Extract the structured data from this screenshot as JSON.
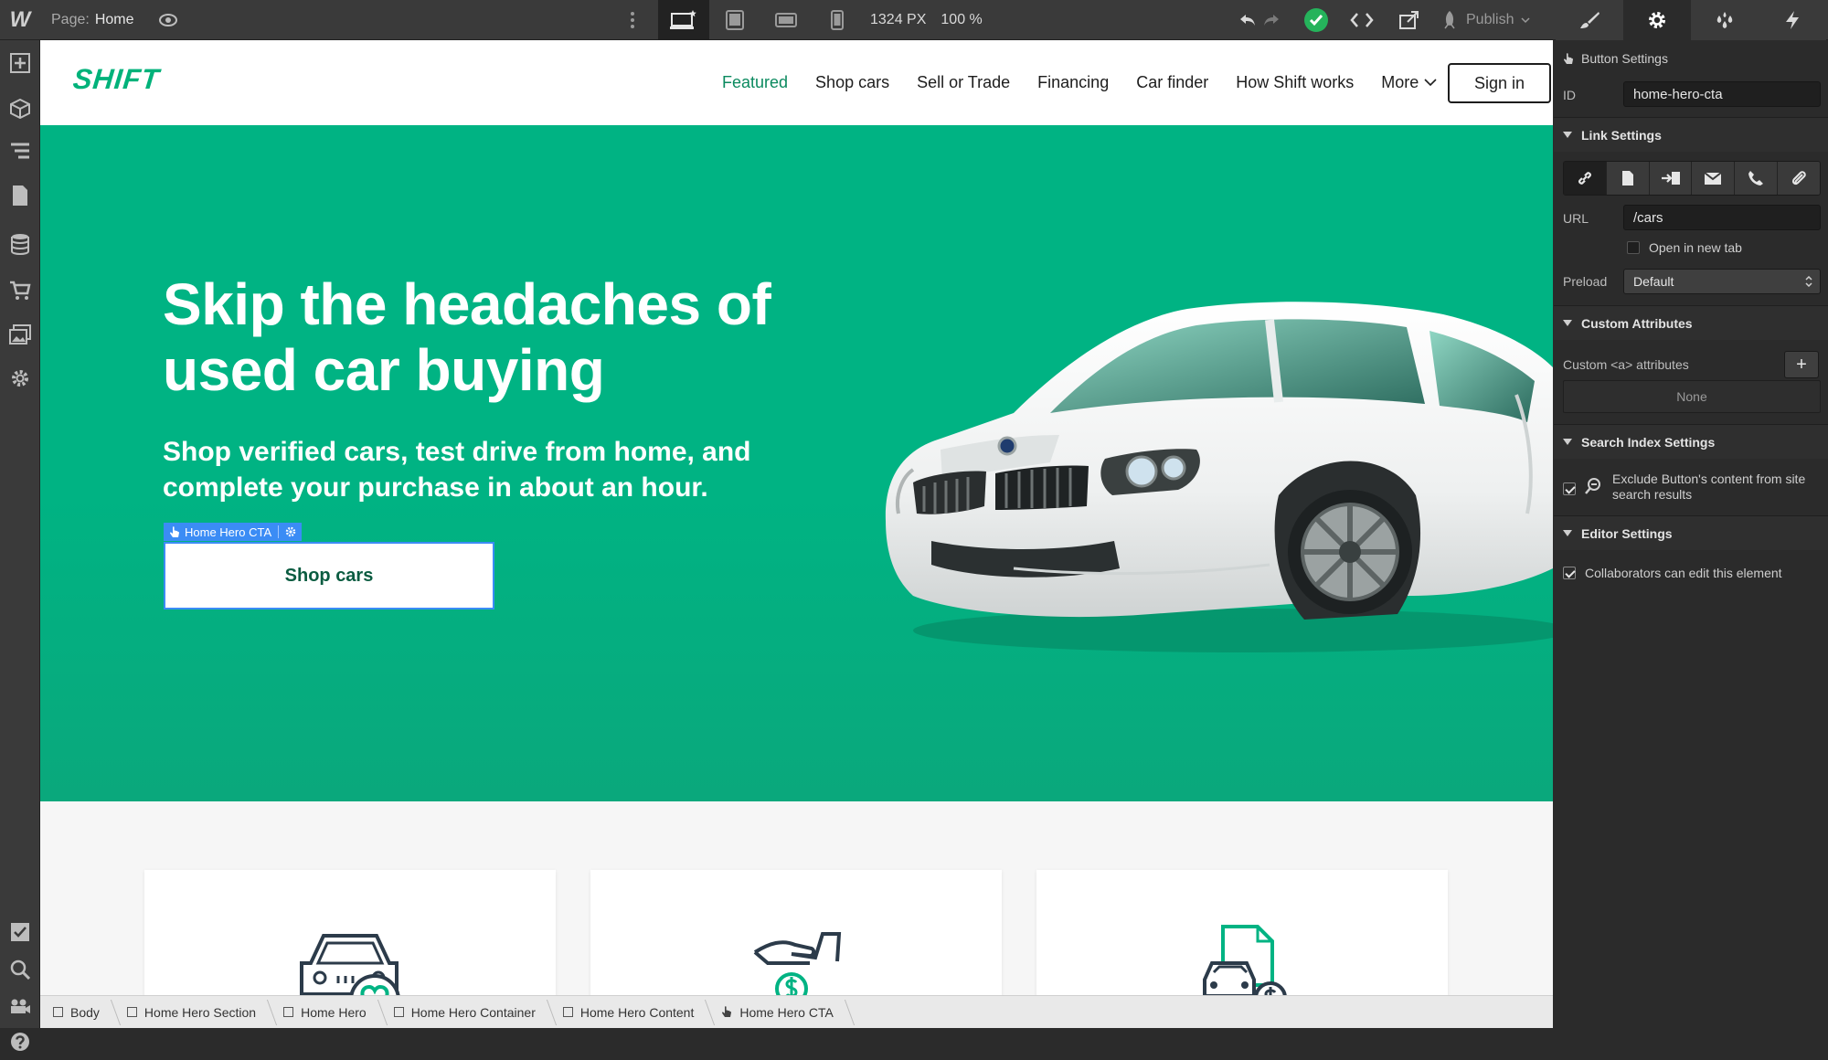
{
  "topbar": {
    "logo": "W",
    "page_label": "Page:",
    "page_name": "Home",
    "canvas_width": "1324 PX",
    "zoom": "100 %",
    "publish_label": "Publish"
  },
  "site": {
    "logo": "SHIFT",
    "nav": [
      {
        "label": "Featured",
        "active": true
      },
      {
        "label": "Shop cars"
      },
      {
        "label": "Sell or Trade"
      },
      {
        "label": "Financing"
      },
      {
        "label": "Car finder"
      },
      {
        "label": "How Shift works"
      }
    ],
    "nav_more": "More",
    "signin": "Sign in",
    "hero": {
      "title": "Skip the headaches of used car buying",
      "subtitle": "Shop verified cars, test drive from home, and complete your purchase in about an hour.",
      "cta_tag": "Home Hero CTA",
      "cta_label": "Shop cars"
    },
    "colors": {
      "brand": "#00b383",
      "selection": "#3b8cf5"
    }
  },
  "breadcrumbs": [
    "Body",
    "Home Hero Section",
    "Home Hero",
    "Home Hero Container",
    "Home Hero Content",
    "Home Hero CTA"
  ],
  "panel": {
    "header": "Button Settings",
    "id_label": "ID",
    "id_value": "home-hero-cta",
    "link_settings": "Link Settings",
    "url_label": "URL",
    "url_value": "/cars",
    "open_new_tab": "Open in new tab",
    "preload_label": "Preload",
    "preload_value": "Default",
    "custom_attributes": "Custom Attributes",
    "custom_a_attrs": "Custom <a> attributes",
    "none": "None",
    "search_index": "Search Index Settings",
    "exclude_text": "Exclude Button's content from site search results",
    "editor_settings": "Editor Settings",
    "collaborators": "Collaborators can edit this element"
  }
}
